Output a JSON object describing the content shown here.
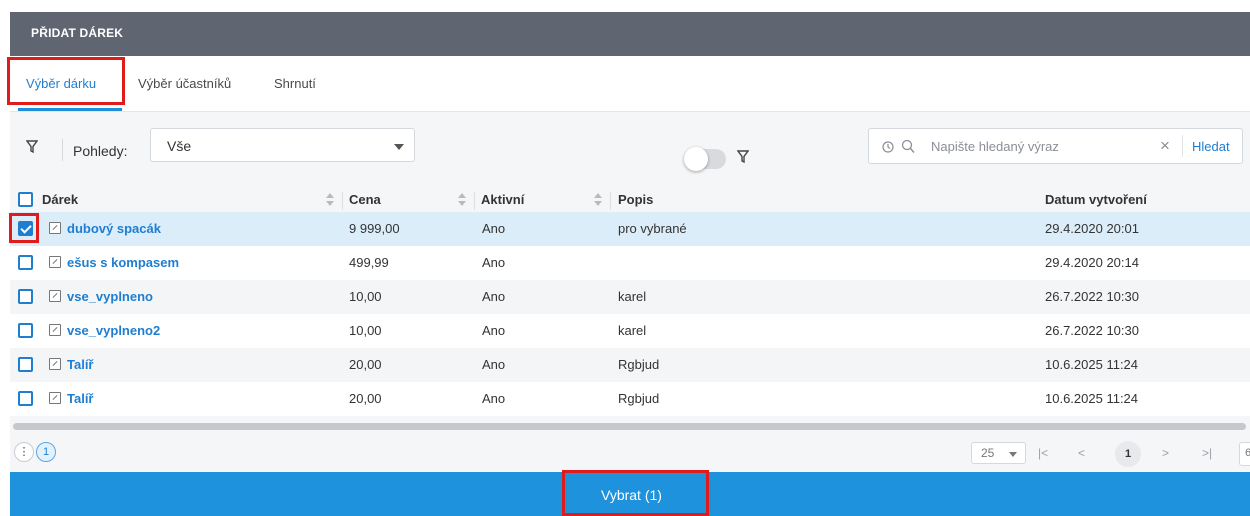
{
  "dialog": {
    "title": "PŘIDAT DÁREK"
  },
  "tabs": [
    {
      "label": "Výběr dárku"
    },
    {
      "label": "Výběr účastníků"
    },
    {
      "label": "Shrnutí"
    }
  ],
  "toolbar": {
    "views_label": "Pohledy:",
    "views_value": "Vše",
    "search_placeholder": "Napište hledaný výraz",
    "search_button": "Hledat"
  },
  "table": {
    "columns": [
      "Dárek",
      "Cena",
      "Aktivní",
      "Popis",
      "Datum vytvoření"
    ],
    "rows": [
      {
        "name": "dubový spacák",
        "price": "9 999,00",
        "active": "Ano",
        "desc": "pro vybrané",
        "date": "29.4.2020 20:01",
        "checked": true
      },
      {
        "name": "ešus s kompasem",
        "price": "499,99",
        "active": "Ano",
        "desc": "",
        "date": "29.4.2020 20:14",
        "checked": false
      },
      {
        "name": "vse_vyplneno",
        "price": "10,00",
        "active": "Ano",
        "desc": "karel",
        "date": "26.7.2022 10:30",
        "checked": false
      },
      {
        "name": "vse_vyplneno2",
        "price": "10,00",
        "active": "Ano",
        "desc": "karel",
        "date": "26.7.2022 10:30",
        "checked": false
      },
      {
        "name": "Talíř",
        "price": "20,00",
        "active": "Ano",
        "desc": "Rgbjud",
        "date": "10.6.2025 11:24",
        "checked": false
      },
      {
        "name": "Talíř",
        "price": "20,00",
        "active": "Ano",
        "desc": "Rgbjud",
        "date": "10.6.2025 11:24",
        "checked": false
      }
    ]
  },
  "footer": {
    "selected_count": "1",
    "page_size": "25",
    "current_page": "1",
    "last_page_partial": "6",
    "first_icon": "first-page-icon",
    "prev_icon": "prev-page-icon",
    "next_icon": "next-page-icon",
    "last_icon": "last-page-icon"
  },
  "action": {
    "label": "Vybrat (1)"
  },
  "colors": {
    "accent": "#1e92dd",
    "header": "#5f6571",
    "highlight": "#e01b1b"
  }
}
